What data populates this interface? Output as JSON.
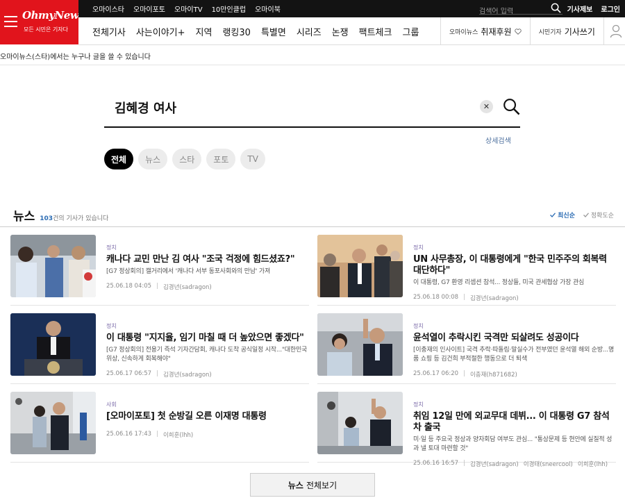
{
  "header": {
    "logo": "OhmyNews",
    "logo_sub": "모든 시민은 기자다",
    "top_links": [
      "오마이스타",
      "오마이포토",
      "오마이TV",
      "10만인클럽",
      "오마이북"
    ],
    "search_placeholder": "검색어 입력",
    "report_label": "기사제보",
    "login_label": "로그인",
    "nav": [
      "전체기사",
      "사는이야기+",
      "지역",
      "랭킹30",
      "특별면",
      "시리즈",
      "논쟁",
      "팩트체크",
      "그룹"
    ],
    "support_small": "오마이뉴스",
    "support_big": "취재후원",
    "write_small": "시민기자",
    "write_big": "기사쓰기"
  },
  "notice": "오마이뉴스(스타)에서는 누구나 글을 쓸 수 있습니다",
  "search": {
    "query": "김혜경 여사",
    "detail_label": "상세검색"
  },
  "filters": [
    "전체",
    "뉴스",
    "스타",
    "포토",
    "TV"
  ],
  "news": {
    "title": "뉴스",
    "count": "103",
    "count_suffix": "건의 기사가 있습니다",
    "sort_latest": "최신순",
    "sort_accuracy": "정확도순",
    "articles": [
      {
        "category": "정치",
        "title": "캐나다 교민 만난 김 여사 \"조국 걱정에 힘드셨죠?\"",
        "summary": "[G7 정상회의] 캘거리에서 '캐나다 서부 동포사회와의 만남' 가져",
        "date": "25.06.18 04:05",
        "author": "김경년(sadragon)"
      },
      {
        "category": "정치",
        "title": "UN 사무총장, 이 대통령에게 \"한국 민주주의 회복력 대단하다\"",
        "summary": "이 대통령, G7 환영 리셉션 참석... 정상들, 미국 관세협상 가장 관심",
        "date": "25.06.18 00:08",
        "author": "김경년(sadragon)"
      },
      {
        "category": "정치",
        "title": "이 대통령 \"지지율, 임기 마칠 때 더 높았으면 좋겠다\"",
        "summary": "[G7 정상회의] 전용기 즉석 기자간담회, 캐나다 도착 공식일정 시작...\"대한민국 위상, 신속하게 회복해야\"",
        "date": "25.06.17 06:57",
        "author": "김경년(sadragon)"
      },
      {
        "category": "정치",
        "title": "윤석열이 추락시킨 국격만 되살려도 성공이다",
        "summary": "[이충재의 인사이트] 국격 추락·따돌림·말실수가 전부였던 윤석열 해외 순방...명품 쇼핑 등 김건희 부적절한 행동으로 더 퇴색",
        "date": "25.06.17 06:20",
        "author": "이충재(h871682)"
      },
      {
        "category": "사회",
        "title": "[오마이포토] 첫 순방길 오른 이재명 대통령",
        "summary": "",
        "date": "25.06.16 17:43",
        "author": "이희훈(lhh)"
      },
      {
        "category": "정치",
        "title": "취임 12일 만에 외교무대 데뷔... 이 대통령 G7 참석차 출국",
        "summary": "미·일 등 주요국 정상과 양자회담 여부도 관심... \"통상문제 등 현안에 실질적 성과 낼 토대 마련할 것\"",
        "date": "25.06.16 16:57",
        "author": "김경년(sadragon)",
        "author2": "이경태(sneercool)",
        "author3": "이희훈(lhh)"
      }
    ],
    "more_bold": "뉴스",
    "more_label": "전체보기"
  },
  "colors": {
    "brand_red": "#e1141c",
    "accent_blue": "#2a6bb3"
  },
  "icons": [
    "menu-icon",
    "search-icon",
    "heart-icon",
    "person-icon",
    "close-icon",
    "check-icon"
  ]
}
